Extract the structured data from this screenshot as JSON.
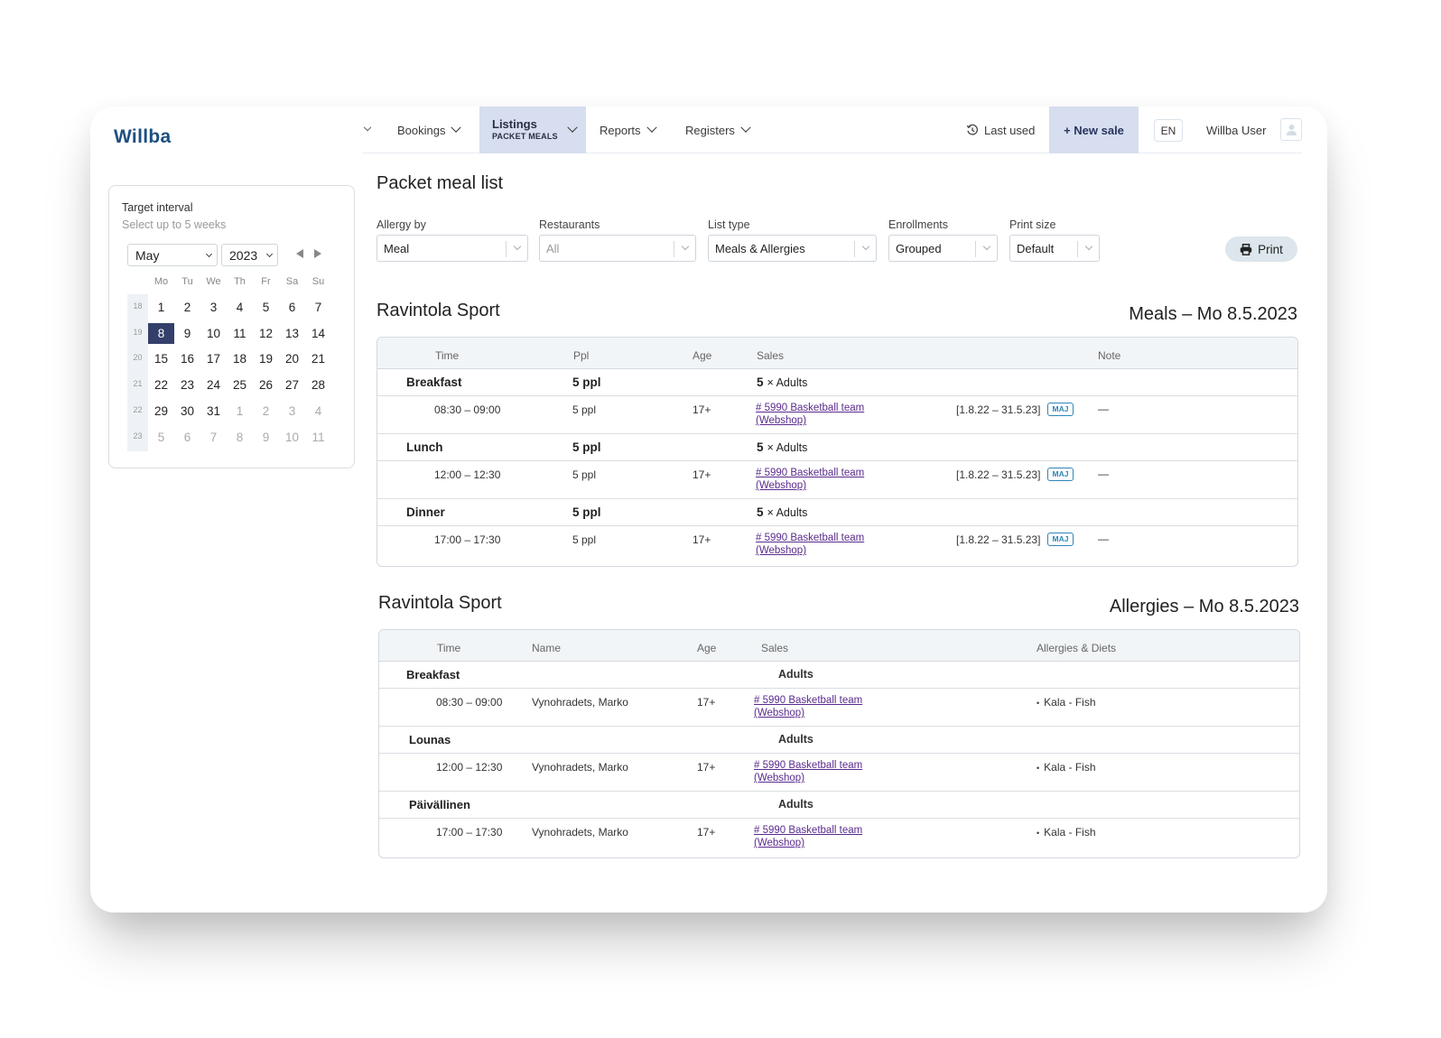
{
  "app": {
    "logo": "Willba"
  },
  "nav": {
    "collapsed_icon": "check-icon",
    "bookings": "Bookings",
    "listings": {
      "title": "Listings",
      "subtitle": "PACKET MEALS"
    },
    "reports": "Reports",
    "registers": "Registers",
    "last_used": "Last used",
    "new_sale": "+ New sale",
    "language": "EN",
    "user": "Willba User"
  },
  "calendar": {
    "title": "Target interval",
    "subtitle": "Select up to 5 weeks",
    "month": "May",
    "year": "2023",
    "weekdays": [
      "Mo",
      "Tu",
      "We",
      "Th",
      "Fr",
      "Sa",
      "Su"
    ],
    "selected_day": "8",
    "weeks": [
      {
        "num": "18",
        "days": [
          [
            "1",
            0
          ],
          [
            "2",
            0
          ],
          [
            "3",
            0
          ],
          [
            "4",
            0
          ],
          [
            "5",
            0
          ],
          [
            "6",
            0
          ],
          [
            "7",
            0
          ]
        ]
      },
      {
        "num": "19",
        "days": [
          [
            "8",
            0
          ],
          [
            "9",
            0
          ],
          [
            "10",
            0
          ],
          [
            "11",
            0
          ],
          [
            "12",
            0
          ],
          [
            "13",
            0
          ],
          [
            "14",
            0
          ]
        ]
      },
      {
        "num": "20",
        "days": [
          [
            "15",
            0
          ],
          [
            "16",
            0
          ],
          [
            "17",
            0
          ],
          [
            "18",
            0
          ],
          [
            "19",
            0
          ],
          [
            "20",
            0
          ],
          [
            "21",
            0
          ]
        ]
      },
      {
        "num": "21",
        "days": [
          [
            "22",
            0
          ],
          [
            "23",
            0
          ],
          [
            "24",
            0
          ],
          [
            "25",
            0
          ],
          [
            "26",
            0
          ],
          [
            "27",
            0
          ],
          [
            "28",
            0
          ]
        ]
      },
      {
        "num": "22",
        "days": [
          [
            "29",
            0
          ],
          [
            "30",
            0
          ],
          [
            "31",
            0
          ],
          [
            "1",
            1
          ],
          [
            "2",
            1
          ],
          [
            "3",
            1
          ],
          [
            "4",
            1
          ]
        ]
      },
      {
        "num": "23",
        "days": [
          [
            "5",
            1
          ],
          [
            "6",
            1
          ],
          [
            "7",
            1
          ],
          [
            "8",
            1
          ],
          [
            "9",
            1
          ],
          [
            "10",
            1
          ],
          [
            "11",
            1
          ]
        ]
      }
    ]
  },
  "page": {
    "title": "Packet meal list"
  },
  "filters": {
    "allergy_by": {
      "label": "Allergy by",
      "value": "Meal"
    },
    "restaurants": {
      "label": "Restaurants",
      "value": "All"
    },
    "list_type": {
      "label": "List type",
      "value": "Meals & Allergies"
    },
    "enrollments": {
      "label": "Enrollments",
      "value": "Grouped"
    },
    "print_size": {
      "label": "Print size",
      "value": "Default"
    },
    "print_button": "Print"
  },
  "meals": {
    "restaurant": "Ravintola Sport",
    "heading": "Meals – Mo 8.5.2023",
    "columns": {
      "time": "Time",
      "ppl": "Ppl",
      "age": "Age",
      "sales": "Sales",
      "note": "Note"
    },
    "groups": [
      {
        "name": "Breakfast",
        "ppl": "5 ppl",
        "sales_count": "5",
        "sales_type": "× Adults",
        "item": {
          "time": "08:30 – 09:00",
          "ppl": "5 ppl",
          "age": "17+",
          "sale_line1": "# 5990 Basketball team",
          "sale_line2": "(Webshop)",
          "period": "[1.8.22 – 31.5.23]",
          "badge": "MAJ",
          "note": "—"
        }
      },
      {
        "name": "Lunch",
        "ppl": "5 ppl",
        "sales_count": "5",
        "sales_type": "× Adults",
        "item": {
          "time": "12:00 – 12:30",
          "ppl": "5 ppl",
          "age": "17+",
          "sale_line1": "# 5990 Basketball team",
          "sale_line2": "(Webshop)",
          "period": "[1.8.22 – 31.5.23]",
          "badge": "MAJ",
          "note": "—"
        }
      },
      {
        "name": "Dinner",
        "ppl": "5 ppl",
        "sales_count": "5",
        "sales_type": "× Adults",
        "item": {
          "time": "17:00 – 17:30",
          "ppl": "5 ppl",
          "age": "17+",
          "sale_line1": "# 5990 Basketball team",
          "sale_line2": "(Webshop)",
          "period": "[1.8.22 – 31.5.23]",
          "badge": "MAJ",
          "note": "—"
        }
      }
    ]
  },
  "allergies": {
    "restaurant": "Ravintola Sport",
    "heading": "Allergies – Mo 8.5.2023",
    "columns": {
      "time": "Time",
      "name": "Name",
      "age": "Age",
      "sales": "Sales",
      "allergies": "Allergies & Diets"
    },
    "groups": [
      {
        "name": "Breakfast",
        "sales_type": "Adults",
        "item": {
          "time": "08:30 – 09:00",
          "name": "Vynohradets, Marko",
          "age": "17+",
          "sale_line1": "# 5990 Basketball team",
          "sale_line2": "(Webshop)",
          "allergy": "Kala - Fish"
        }
      },
      {
        "name": "Lounas",
        "sales_type": "Adults",
        "item": {
          "time": "12:00 – 12:30",
          "name": "Vynohradets, Marko",
          "age": "17+",
          "sale_line1": "# 5990 Basketball team",
          "sale_line2": "(Webshop)",
          "allergy": "Kala - Fish"
        }
      },
      {
        "name": "Päivällinen",
        "sales_type": "Adults",
        "item": {
          "time": "17:00 – 17:30",
          "name": "Vynohradets, Marko",
          "age": "17+",
          "sale_line1": "# 5990 Basketball team",
          "sale_line2": "(Webshop)",
          "allergy": "Kala - Fish"
        }
      }
    ]
  },
  "colors": {
    "brand": "#1d4f80",
    "nav_active": "#d6deef",
    "selected_day": "#34406a",
    "link": "#5a2b8c",
    "badge": "#2d86b8"
  }
}
